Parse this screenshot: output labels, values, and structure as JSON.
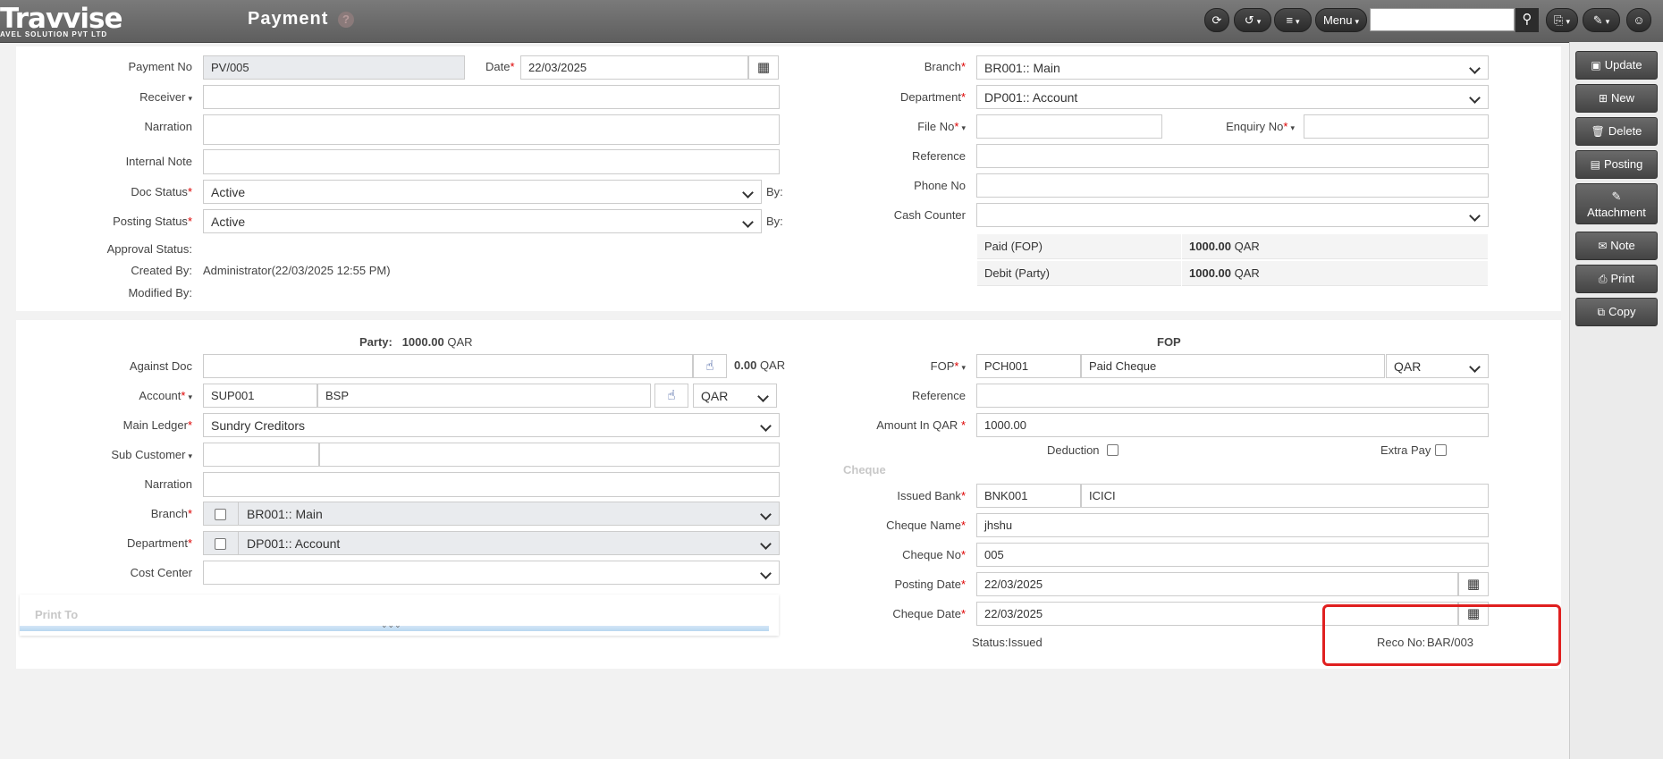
{
  "app": {
    "logo_name": "Travvise",
    "logo_sub": "AVEL SOLUTION PVT LTD",
    "page_title": "Payment",
    "help": "?",
    "menu_label": "Menu"
  },
  "actions": {
    "update": "Update",
    "new": "New",
    "delete": "Delete",
    "posting": "Posting",
    "attachment": "Attachment",
    "note": "Note",
    "print": "Print",
    "copy": "Copy"
  },
  "header": {
    "payment_no_label": "Payment No",
    "payment_no": "PV/005",
    "date_label": "Date",
    "date": "22/03/2025",
    "receiver_label": "Receiver",
    "receiver": "",
    "narration_label": "Narration",
    "narration": "",
    "internal_note_label": "Internal Note",
    "internal_note": "",
    "doc_status_label": "Doc Status",
    "doc_status": "Active",
    "posting_status_label": "Posting Status",
    "posting_status": "Active",
    "by_label": "By:",
    "approval_status_label": "Approval Status:",
    "created_by_label": "Created By:",
    "created_by": "Administrator(22/03/2025 12:55 PM)",
    "modified_by_label": "Modified By:",
    "branch_label": "Branch",
    "branch": "BR001:: Main",
    "department_label": "Department",
    "department": "DP001:: Account",
    "file_no_label": "File No",
    "file_no": "",
    "enquiry_no_label": "Enquiry No",
    "enquiry_no": "",
    "reference_label": "Reference",
    "reference": "",
    "phone_no_label": "Phone No",
    "phone_no": "",
    "cash_counter_label": "Cash Counter",
    "cash_counter": "",
    "paid_fop_label": "Paid (FOP)",
    "paid_fop_amount": "1000.00",
    "debit_party_label": "Debit (Party)",
    "debit_party_amount": "1000.00",
    "currency": "QAR"
  },
  "party": {
    "title_label": "Party:",
    "amount": "1000.00",
    "currency": "QAR",
    "against_doc_label": "Against Doc",
    "against_doc": "",
    "against_amount": "0.00",
    "account_label": "Account",
    "account_code": "SUP001",
    "account_name": "BSP",
    "account_currency": "QAR",
    "main_ledger_label": "Main Ledger",
    "main_ledger": "Sundry Creditors",
    "sub_customer_label": "Sub Customer",
    "narration_label": "Narration",
    "branch_label": "Branch",
    "branch": "BR001:: Main",
    "department_label": "Department",
    "department": "DP001:: Account",
    "cost_center_label": "Cost Center",
    "print_to_label": "Print To",
    "expand": "⌄⌄⌄"
  },
  "fop": {
    "title": "FOP",
    "fop_label": "FOP",
    "fop_code": "PCH001",
    "fop_name": "Paid Cheque",
    "fop_currency": "QAR",
    "reference_label": "Reference",
    "reference": "",
    "amount_label": "Amount In QAR",
    "amount": "1000.00",
    "deduction_label": "Deduction",
    "extra_pay_label": "Extra Pay",
    "cheque_section": "Cheque",
    "issued_bank_label": "Issued Bank",
    "issued_bank_code": "BNK001",
    "issued_bank_name": "ICICI",
    "cheque_name_label": "Cheque Name",
    "cheque_name": "jhshu",
    "cheque_no_label": "Cheque No",
    "cheque_no": "005",
    "posting_date_label": "Posting Date",
    "posting_date": "22/03/2025",
    "cheque_date_label": "Cheque Date",
    "cheque_date": "22/03/2025",
    "status": "Status:Issued",
    "reco_no_label": "Reco No:",
    "reco_no": "BAR/003"
  },
  "colors": {
    "topbar": "#666666",
    "highlight_box": "#e02020",
    "required": "#dd0000"
  }
}
